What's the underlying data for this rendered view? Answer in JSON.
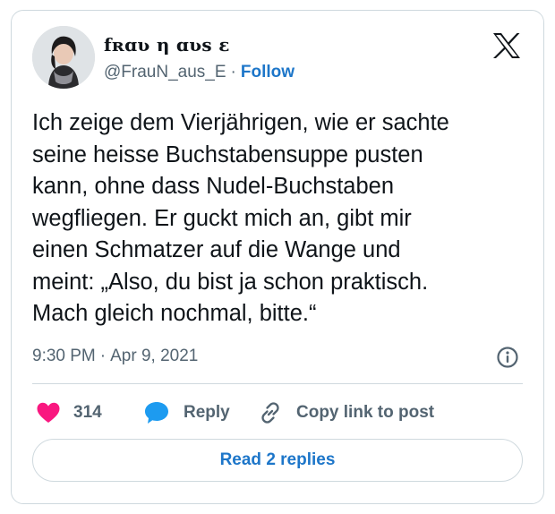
{
  "author": {
    "display_name": "fʀɑʋ η ɑʋѕ ɛ",
    "handle": "@FrauN_aus_E",
    "separator": "·",
    "follow_label": "Follow"
  },
  "tweet": {
    "text_lines": [
      "Ich zeige dem Vierjährigen, wie er sachte",
      "seine heisse Buchstabensuppe pusten",
      "kann, ohne dass Nudel-Buchstaben",
      "wegfliegen. Er guckt mich an, gibt mir",
      "einen Schmatzer auf die Wange und",
      "meint: „Also, du bist ja schon praktisch.",
      "Mach gleich nochmal, bitte.“"
    ],
    "time": "9:30 PM",
    "date_separator": "·",
    "date": "Apr 9, 2021"
  },
  "actions": {
    "like_count": "314",
    "reply_label": "Reply",
    "copy_label": "Copy link to post"
  },
  "footer": {
    "read_replies_label": "Read 2 replies"
  },
  "icons": {
    "brand": "x-logo-icon",
    "info": "info-icon",
    "like": "heart-icon",
    "reply": "speech-bubble-icon",
    "copy": "link-icon"
  },
  "colors": {
    "accent": "#1d76c9",
    "like": "#f91880",
    "reply": "#1d9bf0",
    "muted": "#536471",
    "border": "#cfd9de"
  }
}
